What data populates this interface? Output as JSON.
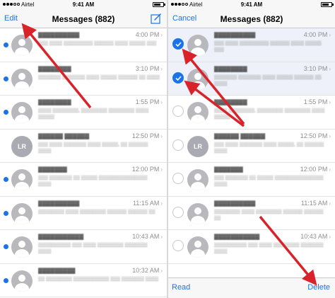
{
  "colors": {
    "accent": "#1a73e8",
    "arrow": "#d9232b",
    "selected_row": "#eef1f9"
  },
  "left": {
    "status": {
      "carrier": "Airtel",
      "time": "9:41 AM"
    },
    "nav": {
      "left_label": "Edit",
      "title": "Messages (882)",
      "right_icon": "compose-icon"
    },
    "rows": [
      {
        "name": "▓▓▓▓▓▓▓▓▓▓",
        "time": "4:00 PM",
        "preview": "▒▒▒ ▒▒▒▒ ▒▒▒▒▒▒▒▒▒ ▒▒▒▒▒▒ ▒▒▒▒ ▒▒▒▒▒ ▒▒▒",
        "unread": true,
        "avatar": ""
      },
      {
        "name": "▓▓▓▓▓▓▓▓",
        "time": "3:10 PM",
        "preview": "▒▒▒▒▒▒▒ ▒▒▒▒▒▒▒ ▒▒▒▒ ▒▒▒▒▒ ▒▒▒▒▒▒ ▒▒ ▒▒▒▒",
        "unread": true,
        "avatar": ""
      },
      {
        "name": "▓▓▓▓▓▓▓▓",
        "time": "1:55 PM",
        "preview": "▒▒▒▒ ▒▒▒▒▒▒▒▒, ▒▒▒▒▒▒▒▒ ▒▒▒▒▒▒▒▒ ▒▒▒▒ ▒▒▒▒▒",
        "unread": true,
        "avatar": ""
      },
      {
        "name": "▓▓▓▓▓▓ ▓▓▓▓▓▓",
        "time": "12:50 PM",
        "preview": "▒▒▒ ▒▒▒▒ ▒▒▒▒▒▒▒ ▒▒▒▒ ▒▒▒▒▒, ▒▒ ▒▒▒▒▒▒ ▒▒▒▒",
        "unread": false,
        "avatar": "LR"
      },
      {
        "name": "▓▓▓▓▓▓▓",
        "time": "12:00 PM",
        "preview": "▒▒▒ ▒▒▒▒▒▒▒ ▒▒ ▒▒▒▒▒ ▒▒▒▒▒▒▒▒▒▒▒▒▒▒▒ ▒▒▒▒",
        "unread": true,
        "avatar": ""
      },
      {
        "name": "▓▓▓▓▓▓▓▓▓▓",
        "time": "11:15 AM",
        "preview": "▒▒▒▒▒▒▒▒ ▒▒▒▒ ▒▒▒▒▒▒▒▒ ▒▒▒▒▒▒ ▒▒▒▒▒▒ ▒▒",
        "unread": true,
        "avatar": ""
      },
      {
        "name": "▓▓▓▓▓▓▓▓▓▓▓",
        "time": "10:43 AM",
        "preview": "▒▒▒▒▒▒▒▒▒▒ ▒▒▒ ▒▒▒▒ ▒▒▒▒▒▒▒▒ ▒▒▒▒▒▒▒ ▒▒▒▒",
        "unread": true,
        "avatar": ""
      },
      {
        "name": "▓▓▓▓▓▓▓▓▓",
        "time": "10:32 AM",
        "preview": "▒▒ ▒▒▒▒▒▒▒▒ ▒▒▒▒▒▒▒▒▒▒▒ ▒▒▒ ▒▒▒▒▒▒▒ ▒▒▒▒",
        "unread": true,
        "avatar": ""
      }
    ]
  },
  "right": {
    "status": {
      "carrier": "Airtel",
      "time": "9:41 AM"
    },
    "nav": {
      "left_label": "Cancel",
      "title": "Messages (882)"
    },
    "rows": [
      {
        "name": "▓▓▓▓▓▓▓▓▓▓",
        "time": "4:00 PM",
        "preview": "▒▒▒ ▒▒▒▒ ▒▒▒▒▒▒▒▒▒ ▒▒▒▒▒▒ ▒▒▒▒ ▒▒▒▒▒ ▒▒▒",
        "selected": true,
        "avatar": ""
      },
      {
        "name": "▓▓▓▓▓▓▓▓",
        "time": "3:10 PM",
        "preview": "▒▒▒▒▒▒▒ ▒▒▒▒▒▒▒ ▒▒▒▒ ▒▒▒▒▒ ▒▒▒▒▒▒ ▒▒ ▒▒▒▒",
        "selected": true,
        "avatar": ""
      },
      {
        "name": "▓▓▓▓▓▓▓▓",
        "time": "1:55 PM",
        "preview": "▒▒▒▒ ▒▒▒▒▒▒▒▒, ▒▒▒▒▒▒▒▒ ▒▒▒▒▒▒▒▒ ▒▒▒▒ ▒▒▒▒▒",
        "selected": false,
        "avatar": ""
      },
      {
        "name": "▓▓▓▓▓▓ ▓▓▓▓▓▓",
        "time": "12:50 PM",
        "preview": "▒▒▒ ▒▒▒▒ ▒▒▒▒▒▒▒ ▒▒▒▒ ▒▒▒▒▒, ▒▒ ▒▒▒▒▒▒ ▒▒▒▒",
        "selected": false,
        "avatar": "LR"
      },
      {
        "name": "▓▓▓▓▓▓▓",
        "time": "12:00 PM",
        "preview": "▒▒▒ ▒▒▒▒▒▒▒ ▒▒ ▒▒▒▒▒ ▒▒▒▒▒▒▒▒▒▒▒▒▒▒▒ ▒▒▒▒",
        "selected": false,
        "avatar": ""
      },
      {
        "name": "▓▓▓▓▓▓▓▓▓▓",
        "time": "11:15 AM",
        "preview": "▒▒▒▒▒▒▒▒ ▒▒▒▒ ▒▒▒▒▒▒▒▒ ▒▒▒▒▒▒ ▒▒▒▒▒▒ ▒▒",
        "selected": false,
        "avatar": ""
      },
      {
        "name": "▓▓▓▓▓▓▓▓▓▓▓",
        "time": "10:43 AM",
        "preview": "▒▒▒▒▒▒▒▒▒▒ ▒▒▒ ▒▒▒▒ ▒▒▒▒▒▒▒▒ ▒▒▒▒▒▒▒ ▒▒▒▒",
        "selected": false,
        "avatar": ""
      }
    ],
    "toolbar": {
      "read_label": "Read",
      "delete_label": "Delete"
    }
  }
}
